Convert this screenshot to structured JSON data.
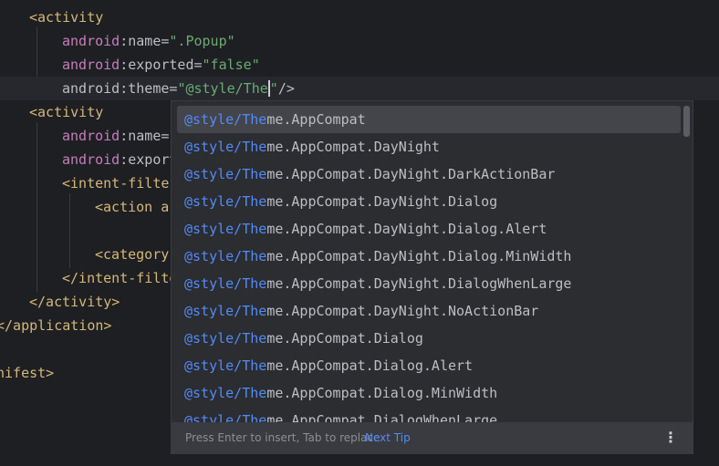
{
  "editor": {
    "line0_tail": "...",
    "line1": {
      "open": "<activity"
    },
    "line2": {
      "ns": "android",
      "attr": ":name=",
      "value": "\".Popup\""
    },
    "line3": {
      "ns": "android",
      "attr": ":exported=",
      "value": "\"false\""
    },
    "line4": {
      "ns": "android",
      "attr": ":theme=",
      "value_before": "\"@style/The",
      "value_after": "\"",
      "close": "/>"
    },
    "line5": {
      "open": "<activity"
    },
    "line6": {
      "ns": "android",
      "attr": ":name="
    },
    "line7": {
      "ns": "android",
      "attr": ":export"
    },
    "line8": {
      "open": "<intent-filte"
    },
    "line9": {
      "open": "<action a"
    },
    "line11": {
      "open": "<category"
    },
    "line12": {
      "close": "</intent-filte"
    },
    "line13": {
      "close": "</activity>"
    },
    "line14": {
      "close": "</application>"
    },
    "line16": {
      "close": "nifest>"
    }
  },
  "completion": {
    "match_prefix": "@style/The",
    "items": [
      "me.AppCompat",
      "me.AppCompat.DayNight",
      "me.AppCompat.DayNight.DarkActionBar",
      "me.AppCompat.DayNight.Dialog",
      "me.AppCompat.DayNight.Dialog.Alert",
      "me.AppCompat.DayNight.Dialog.MinWidth",
      "me.AppCompat.DayNight.DialogWhenLarge",
      "me.AppCompat.DayNight.NoActionBar",
      "me.AppCompat.Dialog",
      "me.AppCompat.Dialog.Alert",
      "me.AppCompat.Dialog.MinWidth",
      "me.AppCompat.DialogWhenLarge"
    ],
    "selected_index": 0,
    "footer": {
      "hint": "Press Enter to insert, Tab to replace",
      "next_tip": "Next Tip",
      "more_icon": "more-vertical-icon"
    }
  },
  "colors": {
    "background": "#1e1f22",
    "tag": "#d5b778",
    "namespace": "#c77dbb",
    "string": "#6aab73",
    "match": "#548af7",
    "popup": "#2b2d30",
    "selection": "#43454a"
  }
}
